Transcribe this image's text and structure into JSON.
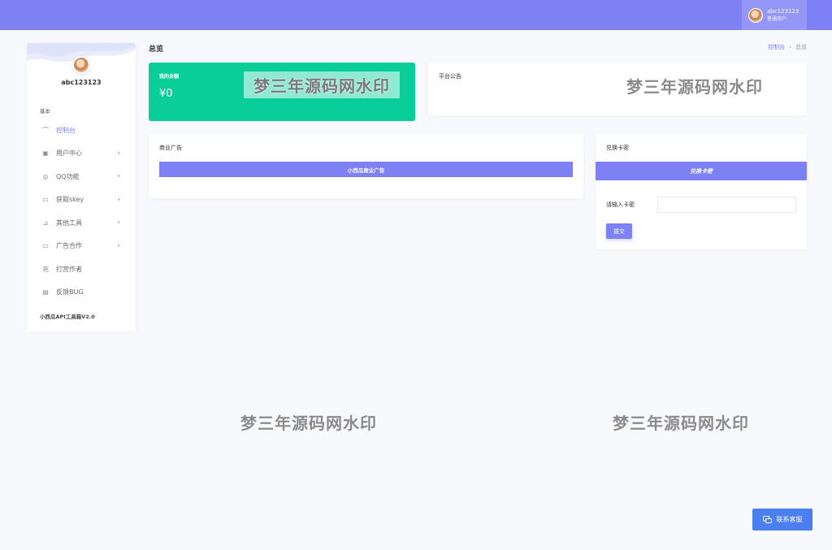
{
  "header": {
    "username": "abc123123",
    "role": "普通用户"
  },
  "sidebar": {
    "username": "abc123123",
    "section": "基本",
    "items": [
      {
        "label": "控制台",
        "icon": "dashboard-icon",
        "glyph": "⌒",
        "active": true,
        "arrow": false
      },
      {
        "label": "用户中心",
        "icon": "user-card-icon",
        "glyph": "▣",
        "active": false,
        "arrow": true
      },
      {
        "label": "QQ功能",
        "icon": "shield-icon",
        "glyph": "◎",
        "active": false,
        "arrow": true
      },
      {
        "label": "获取skey",
        "icon": "monitor-icon",
        "glyph": "▭",
        "active": false,
        "arrow": true
      },
      {
        "label": "其他工具",
        "icon": "chart-icon",
        "glyph": "⊿",
        "active": false,
        "arrow": true
      },
      {
        "label": "广告合作",
        "icon": "screen-icon",
        "glyph": "▭",
        "active": false,
        "arrow": true
      },
      {
        "label": "打赏作者",
        "icon": "charge-icon",
        "glyph": "充",
        "active": false,
        "arrow": false
      },
      {
        "label": "反馈BUG",
        "icon": "feedback-icon",
        "glyph": "▤",
        "active": false,
        "arrow": false
      }
    ],
    "footer": "小西瓜API工具箱V2.0"
  },
  "page": {
    "title": "总览",
    "breadcrumb": [
      "控制台",
      "总览"
    ]
  },
  "balance": {
    "label": "我的余额",
    "amount": "¥0"
  },
  "notice": {
    "title": "平台公告"
  },
  "ad": {
    "title": "商业广告",
    "bar_text": "小西瓜商业广告"
  },
  "redeem": {
    "title": "兑换卡密",
    "bar_text": "兑换卡密",
    "input_label": "请输入卡密",
    "input_value": "",
    "submit_label": "提交"
  },
  "watermark": "梦三年源码网水印",
  "contact": {
    "label": "联系客服"
  },
  "colors": {
    "accent": "#7d81f4",
    "balance_green": "#0ace9a",
    "contact_blue": "#4b7ff0"
  }
}
